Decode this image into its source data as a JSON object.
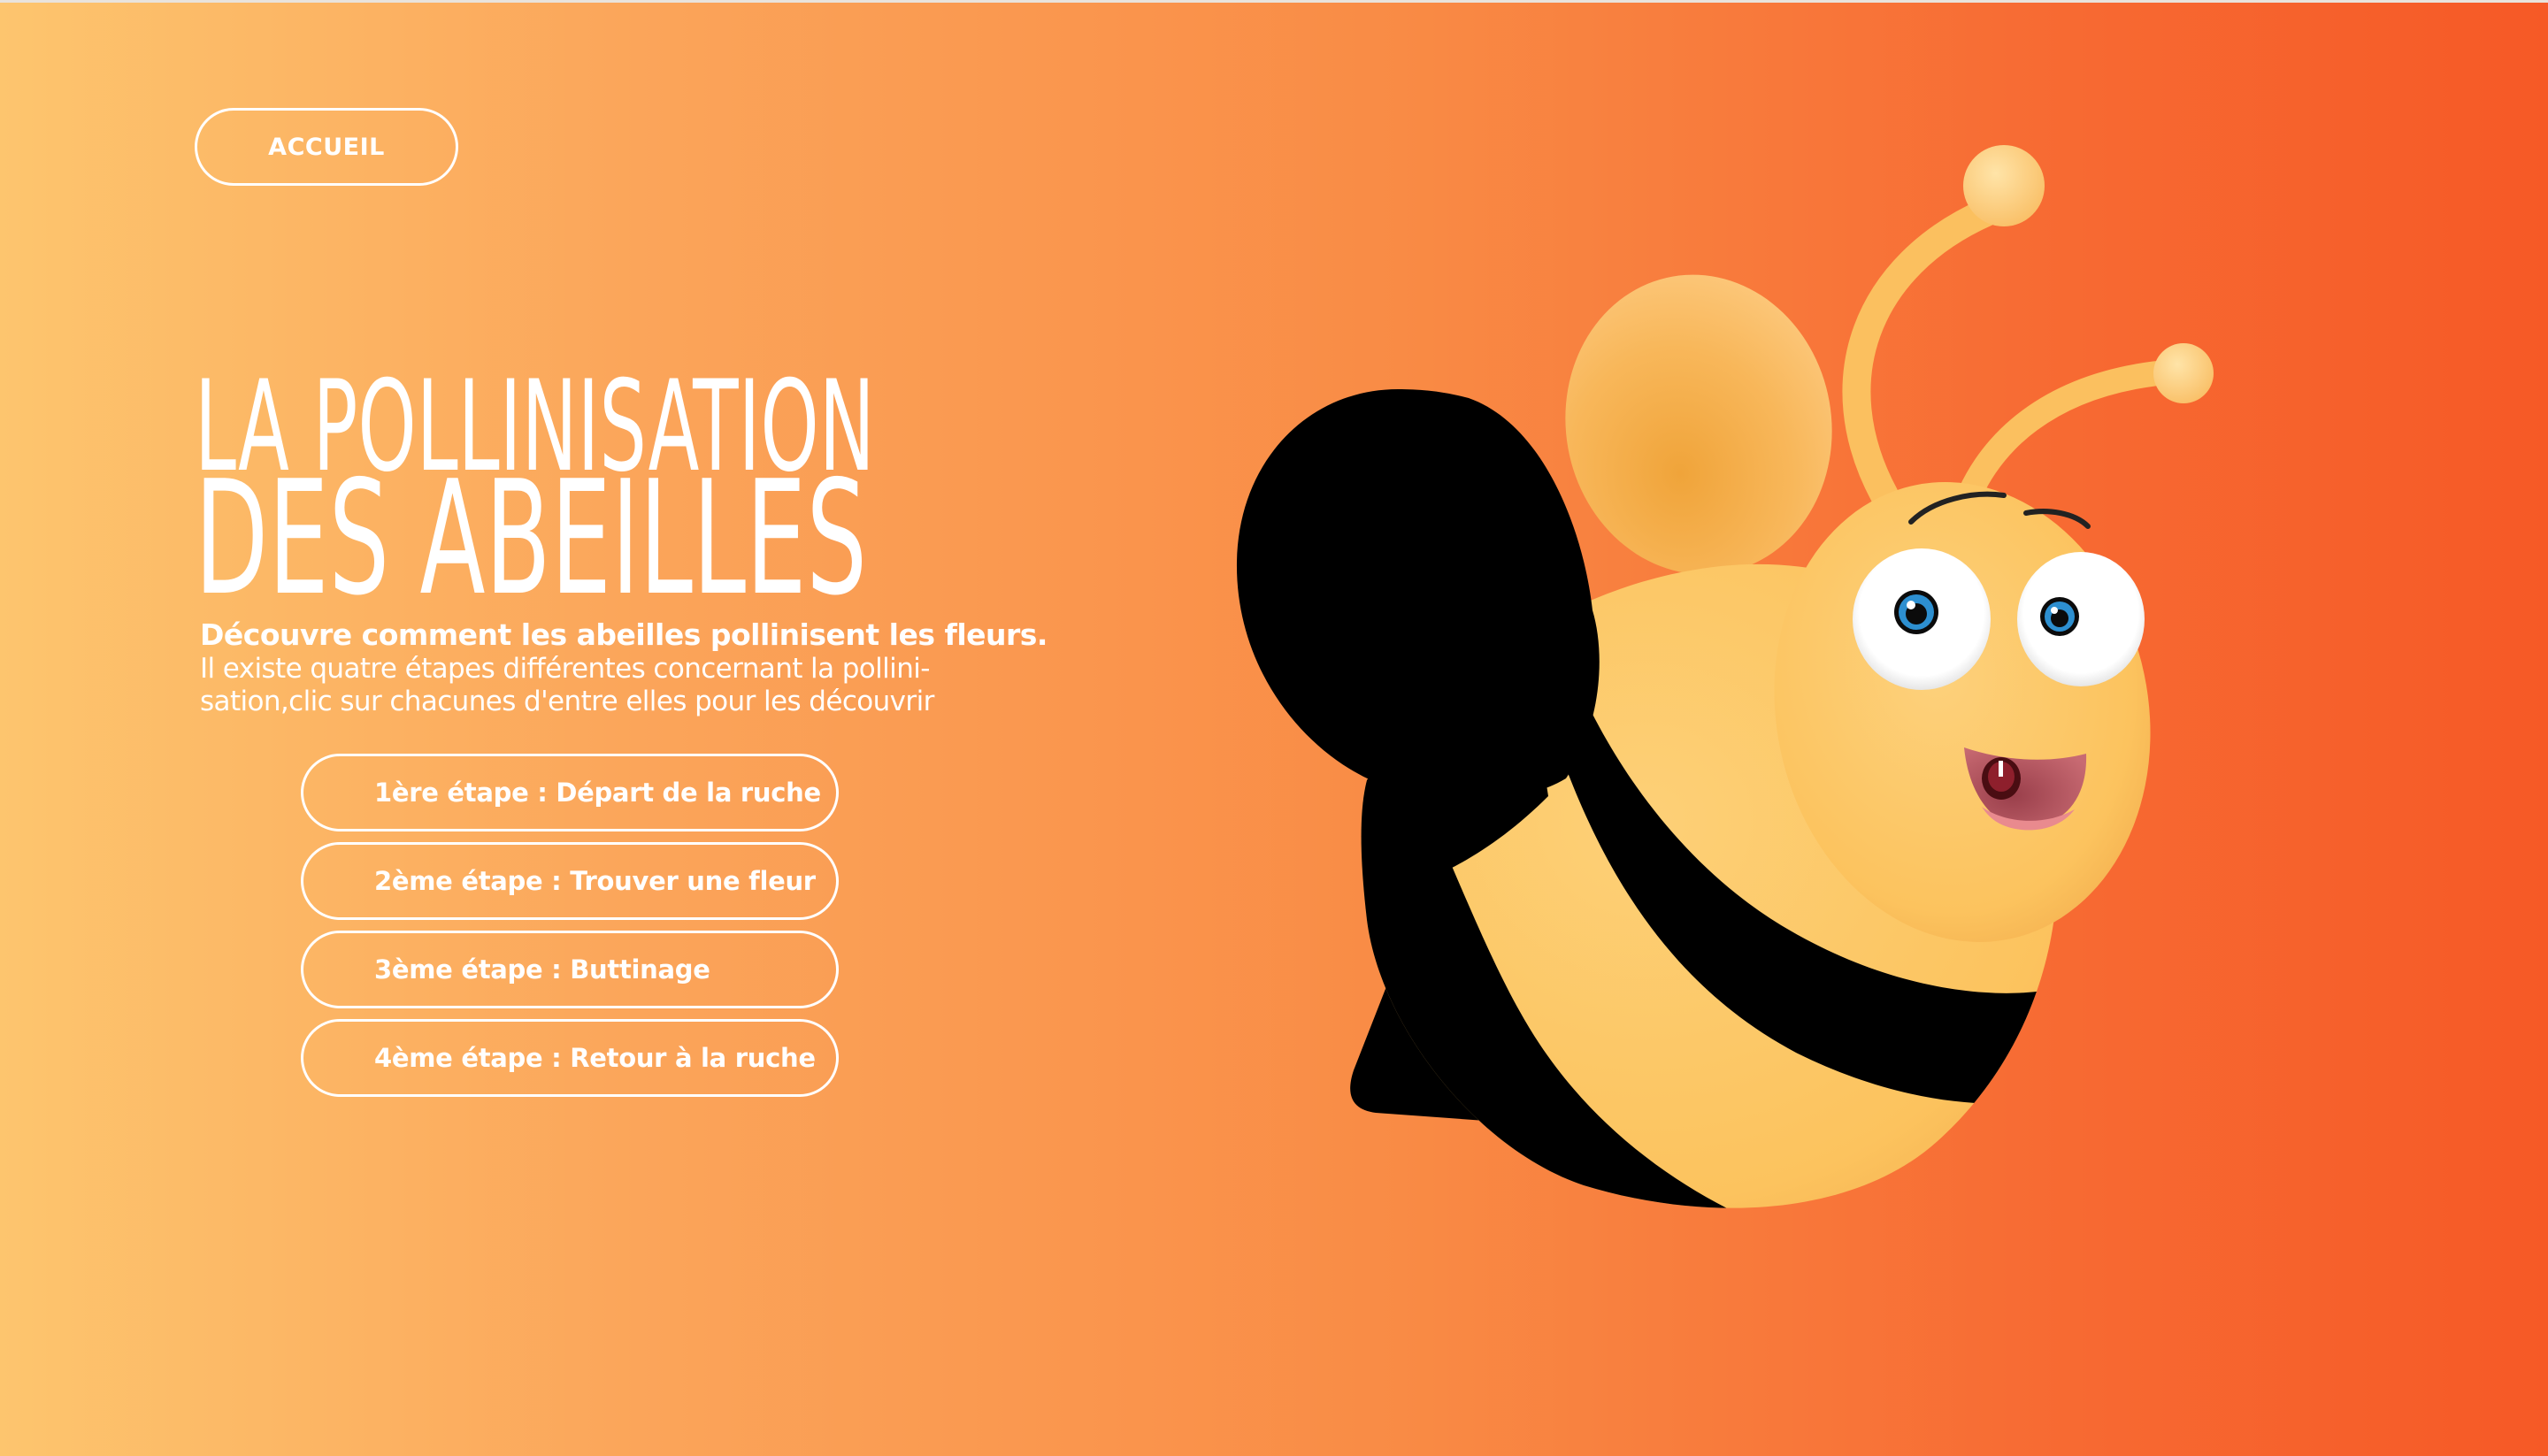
{
  "nav": {
    "home_label": "ACCUEIL"
  },
  "hero": {
    "title_line1": "LA POLLINISATION",
    "title_line2": "DES ABEILLES",
    "subtitle": "Découvre comment les abeilles pollinisent les fleurs.",
    "description_line1": "Il existe quatre étapes différentes concernant la pollini-",
    "description_line2": "sation,clic sur chacunes d'entre elles pour les découvrir"
  },
  "steps": [
    {
      "label": "1ère étape : Départ de la ruche"
    },
    {
      "label": "2ème étape : Trouver une fleur"
    },
    {
      "label": "3ème étape : Buttinage"
    },
    {
      "label": "4ème étape : Retour à la ruche"
    }
  ],
  "illustration": {
    "icon": "bee-illustration"
  },
  "colors": {
    "gradient_start": "#fdc56e",
    "gradient_end": "#f65926",
    "text": "#ffffff",
    "bee_yellow": "#fcc35e",
    "bee_black": "#000000"
  }
}
